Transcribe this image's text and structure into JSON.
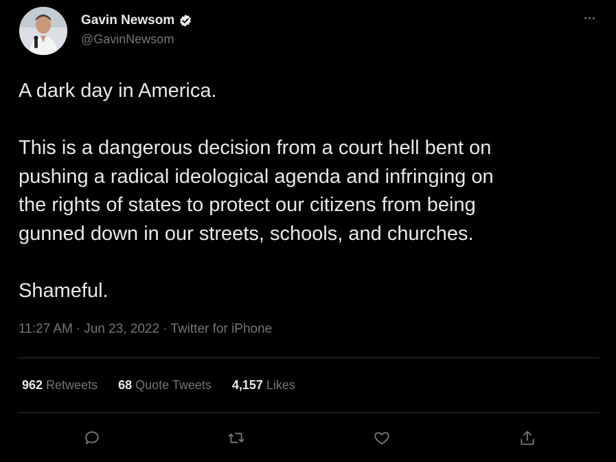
{
  "author": {
    "name": "Gavin Newsom",
    "handle": "@GavinNewsom",
    "verified": true
  },
  "tweet": {
    "line1": "A dark day in America.",
    "line2": "This is a dangerous decision from a court hell bent on\npushing a radical ideological agenda and infringing on\nthe rights of states to protect our citizens from being\ngunned down in our streets, schools, and churches.",
    "line3": "Shameful."
  },
  "meta": {
    "time": "11:27 AM",
    "date": "Jun 23, 2022",
    "source": "Twitter for iPhone",
    "separator": "·"
  },
  "stats": {
    "retweets_count": "962",
    "retweets_label": "Retweets",
    "quotes_count": "68",
    "quotes_label": "Quote Tweets",
    "likes_count": "4,157",
    "likes_label": "Likes"
  },
  "icons": {
    "more": "more-horizontal-icon",
    "reply": "reply-icon",
    "retweet": "retweet-icon",
    "like": "like-heart-icon",
    "share": "share-icon",
    "verified": "verified-badge-icon"
  },
  "colors": {
    "background": "#000000",
    "text": "#e7e9ea",
    "secondary": "#71767b",
    "divider": "#2f3336"
  }
}
